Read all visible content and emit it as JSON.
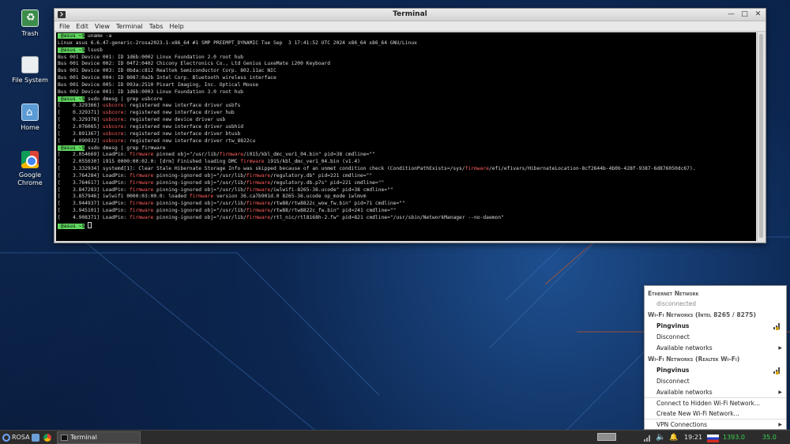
{
  "desktop": {
    "icons": [
      {
        "label": "Trash",
        "icon": "trash-icon"
      },
      {
        "label": "File System",
        "icon": "file-system-icon"
      },
      {
        "label": "Home",
        "icon": "home-folder-icon"
      },
      {
        "label": "Google\nChrome",
        "icon": "chrome-icon"
      }
    ]
  },
  "terminal": {
    "title": "Terminal",
    "menu": [
      "File",
      "Edit",
      "View",
      "Terminal",
      "Tabs",
      "Help"
    ],
    "prompt": " @asus ~$",
    "lines": [
      {
        "segs": [
          {
            "t": " @asus ~$",
            "c": "pr"
          },
          {
            "t": " uname -a"
          }
        ]
      },
      {
        "segs": [
          {
            "t": "Linux asus 6.6.47-generic-2rosa2023.1-x86_64 #1 SMP PREEMPT_DYNAMIC Tue Sep  3 17:41:52 UTC 2024 x86_64 x86_64 GNU/Linux"
          }
        ]
      },
      {
        "segs": [
          {
            "t": " @asus ~$",
            "c": "pr"
          },
          {
            "t": " lsusb"
          }
        ]
      },
      {
        "segs": [
          {
            "t": "Bus 001 Device 001: ID 1d6b:0002 Linux Foundation 2.0 root hub"
          }
        ]
      },
      {
        "segs": [
          {
            "t": "Bus 001 Device 002: ID 04f2:0402 Chicony Electronics Co., Ltd Genius LuxeMate i200 Keyboard"
          }
        ]
      },
      {
        "segs": [
          {
            "t": "Bus 001 Device 003: ID 0bda:c812 Realtek Semiconductor Corp. 802.11ac NIC"
          }
        ]
      },
      {
        "segs": [
          {
            "t": "Bus 001 Device 004: ID 8087:0a2b Intel Corp. Bluetooth wireless interface"
          }
        ]
      },
      {
        "segs": [
          {
            "t": "Bus 001 Device 005: ID 093a:2510 Pixart Imaging, Inc. Optical Mouse"
          }
        ]
      },
      {
        "segs": [
          {
            "t": "Bus 002 Device 001: ID 1d6b:0003 Linux Foundation 3.0 root hub"
          }
        ]
      },
      {
        "segs": [
          {
            "t": " @asus ~$",
            "c": "pr"
          },
          {
            "t": " sudo dmesg | grep usbcore"
          }
        ]
      },
      {
        "segs": [
          {
            "t": "[    0.329366] "
          },
          {
            "t": "usbcore",
            "c": "red"
          },
          {
            "t": ": registered new interface driver usbfs"
          }
        ]
      },
      {
        "segs": [
          {
            "t": "[    0.329371] "
          },
          {
            "t": "usbcore",
            "c": "red"
          },
          {
            "t": ": registered new interface driver hub"
          }
        ]
      },
      {
        "segs": [
          {
            "t": "[    0.329376] "
          },
          {
            "t": "usbcore",
            "c": "red"
          },
          {
            "t": ": registered new device driver usb"
          }
        ]
      },
      {
        "segs": [
          {
            "t": "[    2.076065] "
          },
          {
            "t": "usbcore",
            "c": "red"
          },
          {
            "t": ": registered new interface driver usbhid"
          }
        ]
      },
      {
        "segs": [
          {
            "t": "[    3.891367] "
          },
          {
            "t": "usbcore",
            "c": "red"
          },
          {
            "t": ": registered new interface driver btusb"
          }
        ]
      },
      {
        "segs": [
          {
            "t": "[    4.090932] "
          },
          {
            "t": "usbcore",
            "c": "red"
          },
          {
            "t": ": registered new interface driver rtw_8822cu"
          }
        ]
      },
      {
        "segs": [
          {
            "t": " @asus ~$",
            "c": "pr"
          },
          {
            "t": " sudo dmesg | grep firmware"
          }
        ]
      },
      {
        "segs": [
          {
            "t": "[    2.054669] LoadPin: "
          },
          {
            "t": "firmware",
            "c": "red"
          },
          {
            "t": " pinned obj=\"/usr/lib/"
          },
          {
            "t": "firmware",
            "c": "red"
          },
          {
            "t": "/i915/kbl_dmc_ver1_04.bin\" pid=38 cmdline=\"\""
          }
        ]
      },
      {
        "segs": [
          {
            "t": "[    2.055030] i915 0000:00:02.0: [drm] Finished loading DMC "
          },
          {
            "t": "firmware",
            "c": "red"
          },
          {
            "t": " i915/kbl_dmc_ver1_04.bin (v1.4)"
          }
        ]
      },
      {
        "segs": [
          {
            "t": "[    3.332934] systemd[1]: Clear Stale Hibernate Storage Info was skipped because of an unmet condition check (ConditionPathExists=/sys/"
          },
          {
            "t": "firmware",
            "c": "red"
          },
          {
            "t": "/efi/efivars/HibernateLocation-8cf2644b-4b0b-428f-9387-6d876050dc67)."
          }
        ]
      },
      {
        "segs": [
          {
            "t": "[    3.764284] LoadPin: "
          },
          {
            "t": "firmware",
            "c": "red"
          },
          {
            "t": " pinning-ignored obj=\"/usr/lib/"
          },
          {
            "t": "firmware",
            "c": "red"
          },
          {
            "t": "/regulatory.db\" pid=221 cmdline=\"\""
          }
        ]
      },
      {
        "segs": [
          {
            "t": "[    3.764617] LoadPin: "
          },
          {
            "t": "firmware",
            "c": "red"
          },
          {
            "t": " pinning-ignored obj=\"/usr/lib/"
          },
          {
            "t": "firmware",
            "c": "red"
          },
          {
            "t": "/regulatory.db.p7s\" pid=221 cmdline=\"\""
          }
        ]
      },
      {
        "segs": [
          {
            "t": "[    3.847283] LoadPin: "
          },
          {
            "t": "firmware",
            "c": "red"
          },
          {
            "t": " pinning-ignored obj=\"/usr/lib/"
          },
          {
            "t": "firmware",
            "c": "red"
          },
          {
            "t": "/iwlwifi-8265-36.ucode\" pid=38 cmdline=\"\""
          }
        ]
      },
      {
        "segs": [
          {
            "t": "[    3.857946] iwlwifi 0000:03:00.0: loaded "
          },
          {
            "t": "firmware",
            "c": "red"
          },
          {
            "t": " version 36.ca7b901d.0 8265-36.ucode op_mode iwlmvm"
          }
        ]
      },
      {
        "segs": [
          {
            "t": "[    3.944937] LoadPin: "
          },
          {
            "t": "firmware",
            "c": "red"
          },
          {
            "t": " pinning-ignored obj=\"/usr/lib/"
          },
          {
            "t": "firmware",
            "c": "red"
          },
          {
            "t": "/rtw88/rtw8822c_wow_fw.bin\" pid=71 cmdline=\"\""
          }
        ]
      },
      {
        "segs": [
          {
            "t": "[    3.945101] LoadPin: "
          },
          {
            "t": "firmware",
            "c": "red"
          },
          {
            "t": " pinning-ignored obj=\"/usr/lib/"
          },
          {
            "t": "firmware",
            "c": "red"
          },
          {
            "t": "/rtw88/rtw8822c_fw.bin\" pid=241 cmdline=\"\""
          }
        ]
      },
      {
        "segs": [
          {
            "t": "[    4.908371] LoadPin: "
          },
          {
            "t": "firmware",
            "c": "red"
          },
          {
            "t": " pinning-ignored obj=\"/usr/lib/"
          },
          {
            "t": "firmware",
            "c": "red"
          },
          {
            "t": "/rtl_nic/rtl8168h-2.fw\" pid=821 cmdline=\"/usr/sbin/NetworkManager --no-daemon\""
          }
        ]
      },
      {
        "segs": [
          {
            "t": " @asus ~$",
            "c": "pr"
          },
          {
            "t": " "
          }
        ],
        "cursor": true
      }
    ]
  },
  "network_menu": {
    "ethernet_header": "Ethernet Network",
    "ethernet_status": "disconnected",
    "wifi1_header": "Wi-Fi Networks (Intel 8265 / 8275)",
    "wifi1_network": "Pingvinus",
    "wifi1_disconnect": "Disconnect",
    "wifi1_available": "Available networks",
    "wifi2_header": "Wi-Fi Networks (Realtek Wi-Fi)",
    "wifi2_network": "Pingvinus",
    "wifi2_disconnect": "Disconnect",
    "wifi2_available": "Available networks",
    "connect_hidden": "Connect to Hidden Wi-Fi Network...",
    "create_new": "Create New Wi-Fi Network...",
    "vpn": "VPN Connections"
  },
  "taskbar": {
    "menu_label": "ROSA",
    "task_label": "Terminal",
    "clock": "19:21",
    "cpu_value": "1393.0",
    "temp_value": "35.0"
  },
  "colors": {
    "prompt_bg": "#5fd75f",
    "match_highlight": "#ff5f5f",
    "indicator_green": "#39d353"
  }
}
